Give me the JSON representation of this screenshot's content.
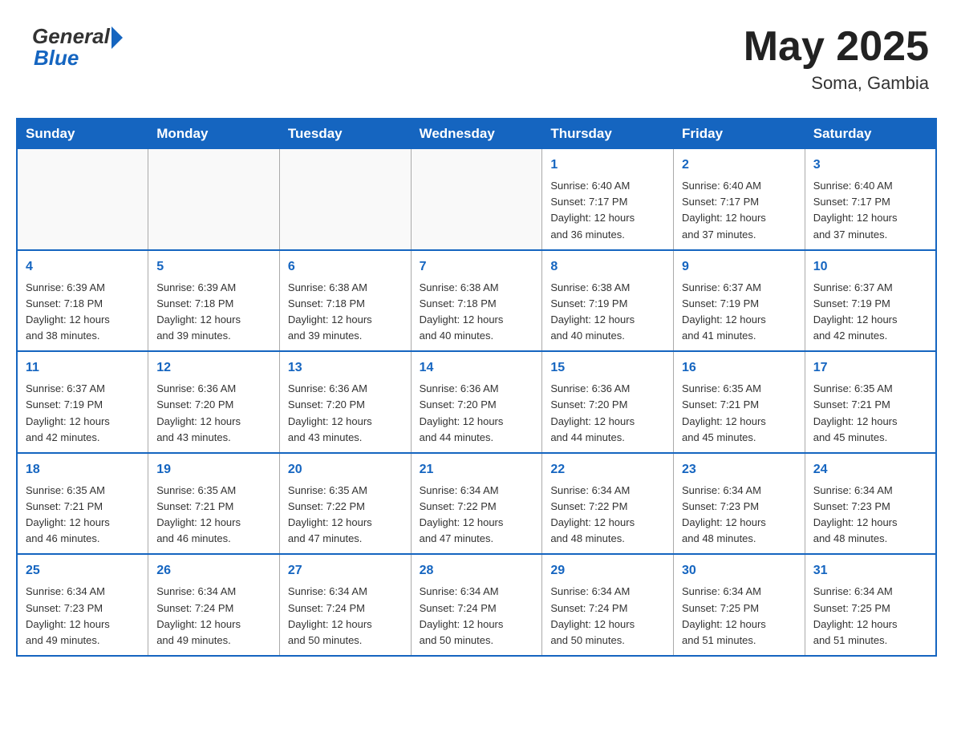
{
  "header": {
    "logo_general": "General",
    "logo_blue": "Blue",
    "month_title": "May 2025",
    "location": "Soma, Gambia"
  },
  "days_of_week": [
    "Sunday",
    "Monday",
    "Tuesday",
    "Wednesday",
    "Thursday",
    "Friday",
    "Saturday"
  ],
  "weeks": [
    [
      {
        "day": "",
        "info": ""
      },
      {
        "day": "",
        "info": ""
      },
      {
        "day": "",
        "info": ""
      },
      {
        "day": "",
        "info": ""
      },
      {
        "day": "1",
        "info": "Sunrise: 6:40 AM\nSunset: 7:17 PM\nDaylight: 12 hours\nand 36 minutes."
      },
      {
        "day": "2",
        "info": "Sunrise: 6:40 AM\nSunset: 7:17 PM\nDaylight: 12 hours\nand 37 minutes."
      },
      {
        "day": "3",
        "info": "Sunrise: 6:40 AM\nSunset: 7:17 PM\nDaylight: 12 hours\nand 37 minutes."
      }
    ],
    [
      {
        "day": "4",
        "info": "Sunrise: 6:39 AM\nSunset: 7:18 PM\nDaylight: 12 hours\nand 38 minutes."
      },
      {
        "day": "5",
        "info": "Sunrise: 6:39 AM\nSunset: 7:18 PM\nDaylight: 12 hours\nand 39 minutes."
      },
      {
        "day": "6",
        "info": "Sunrise: 6:38 AM\nSunset: 7:18 PM\nDaylight: 12 hours\nand 39 minutes."
      },
      {
        "day": "7",
        "info": "Sunrise: 6:38 AM\nSunset: 7:18 PM\nDaylight: 12 hours\nand 40 minutes."
      },
      {
        "day": "8",
        "info": "Sunrise: 6:38 AM\nSunset: 7:19 PM\nDaylight: 12 hours\nand 40 minutes."
      },
      {
        "day": "9",
        "info": "Sunrise: 6:37 AM\nSunset: 7:19 PM\nDaylight: 12 hours\nand 41 minutes."
      },
      {
        "day": "10",
        "info": "Sunrise: 6:37 AM\nSunset: 7:19 PM\nDaylight: 12 hours\nand 42 minutes."
      }
    ],
    [
      {
        "day": "11",
        "info": "Sunrise: 6:37 AM\nSunset: 7:19 PM\nDaylight: 12 hours\nand 42 minutes."
      },
      {
        "day": "12",
        "info": "Sunrise: 6:36 AM\nSunset: 7:20 PM\nDaylight: 12 hours\nand 43 minutes."
      },
      {
        "day": "13",
        "info": "Sunrise: 6:36 AM\nSunset: 7:20 PM\nDaylight: 12 hours\nand 43 minutes."
      },
      {
        "day": "14",
        "info": "Sunrise: 6:36 AM\nSunset: 7:20 PM\nDaylight: 12 hours\nand 44 minutes."
      },
      {
        "day": "15",
        "info": "Sunrise: 6:36 AM\nSunset: 7:20 PM\nDaylight: 12 hours\nand 44 minutes."
      },
      {
        "day": "16",
        "info": "Sunrise: 6:35 AM\nSunset: 7:21 PM\nDaylight: 12 hours\nand 45 minutes."
      },
      {
        "day": "17",
        "info": "Sunrise: 6:35 AM\nSunset: 7:21 PM\nDaylight: 12 hours\nand 45 minutes."
      }
    ],
    [
      {
        "day": "18",
        "info": "Sunrise: 6:35 AM\nSunset: 7:21 PM\nDaylight: 12 hours\nand 46 minutes."
      },
      {
        "day": "19",
        "info": "Sunrise: 6:35 AM\nSunset: 7:21 PM\nDaylight: 12 hours\nand 46 minutes."
      },
      {
        "day": "20",
        "info": "Sunrise: 6:35 AM\nSunset: 7:22 PM\nDaylight: 12 hours\nand 47 minutes."
      },
      {
        "day": "21",
        "info": "Sunrise: 6:34 AM\nSunset: 7:22 PM\nDaylight: 12 hours\nand 47 minutes."
      },
      {
        "day": "22",
        "info": "Sunrise: 6:34 AM\nSunset: 7:22 PM\nDaylight: 12 hours\nand 48 minutes."
      },
      {
        "day": "23",
        "info": "Sunrise: 6:34 AM\nSunset: 7:23 PM\nDaylight: 12 hours\nand 48 minutes."
      },
      {
        "day": "24",
        "info": "Sunrise: 6:34 AM\nSunset: 7:23 PM\nDaylight: 12 hours\nand 48 minutes."
      }
    ],
    [
      {
        "day": "25",
        "info": "Sunrise: 6:34 AM\nSunset: 7:23 PM\nDaylight: 12 hours\nand 49 minutes."
      },
      {
        "day": "26",
        "info": "Sunrise: 6:34 AM\nSunset: 7:24 PM\nDaylight: 12 hours\nand 49 minutes."
      },
      {
        "day": "27",
        "info": "Sunrise: 6:34 AM\nSunset: 7:24 PM\nDaylight: 12 hours\nand 50 minutes."
      },
      {
        "day": "28",
        "info": "Sunrise: 6:34 AM\nSunset: 7:24 PM\nDaylight: 12 hours\nand 50 minutes."
      },
      {
        "day": "29",
        "info": "Sunrise: 6:34 AM\nSunset: 7:24 PM\nDaylight: 12 hours\nand 50 minutes."
      },
      {
        "day": "30",
        "info": "Sunrise: 6:34 AM\nSunset: 7:25 PM\nDaylight: 12 hours\nand 51 minutes."
      },
      {
        "day": "31",
        "info": "Sunrise: 6:34 AM\nSunset: 7:25 PM\nDaylight: 12 hours\nand 51 minutes."
      }
    ]
  ]
}
